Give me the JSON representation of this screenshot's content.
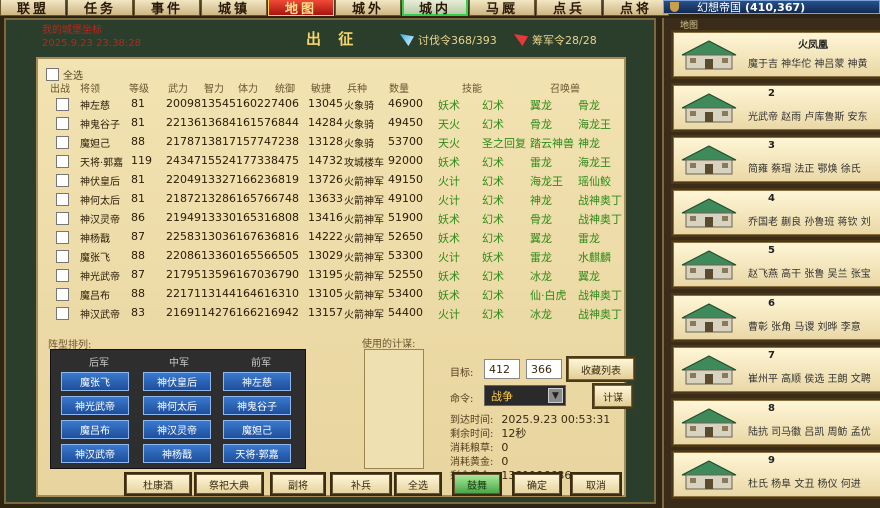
{
  "nav": {
    "tabs": [
      "联盟",
      "任务",
      "事件",
      "城镇",
      "地图",
      "城外",
      "城内",
      "马厩",
      "点兵",
      "点将"
    ],
    "active_index": 4
  },
  "empire": {
    "name": "幻想帝国",
    "coords": "(410,367)"
  },
  "background_info": {
    "line1": "我的城堡坐标",
    "line2": "2025.9.23 23:38:28"
  },
  "dialog": {
    "title": "出 征",
    "counter_1": "讨伐令368/393",
    "counter_2": "筹军令28/28"
  },
  "roster": {
    "select_all_label": "全选",
    "headers": [
      "出战",
      "将领",
      "等级",
      "武力",
      "智力",
      "体力",
      "统御",
      "敏捷",
      "兵种",
      "数量",
      "技能",
      "召唤兽"
    ],
    "rows": [
      {
        "name": "神左慈",
        "level": "81",
        "wu": "20098",
        "zhi": "13545",
        "ti": "160227",
        "tong": "406",
        "min": "13045",
        "bing": "火象骑",
        "num": "46900",
        "s1": "妖术",
        "s2": "幻术",
        "b1": "翼龙",
        "b2": "骨龙"
      },
      {
        "name": "神鬼谷子",
        "level": "81",
        "wu": "22136",
        "zhi": "13684",
        "ti": "161576",
        "tong": "844",
        "min": "14284",
        "bing": "火象骑",
        "num": "49450",
        "s1": "天火",
        "s2": "幻术",
        "b1": "骨龙",
        "b2": "海龙王"
      },
      {
        "name": "魔妲己",
        "level": "88",
        "wu": "21787",
        "zhi": "13817",
        "ti": "157747",
        "tong": "238",
        "min": "13128",
        "bing": "火象骑",
        "num": "53700",
        "s1": "天火",
        "s2": "圣之回复",
        "b1": "踏云神兽",
        "b2": "神龙"
      },
      {
        "name": "天将·郭嘉",
        "level": "119",
        "wu": "24347",
        "zhi": "15524",
        "ti": "177338",
        "tong": "475",
        "min": "14732",
        "bing": "攻城楼车",
        "num": "92000",
        "s1": "妖术",
        "s2": "幻术",
        "b1": "雷龙",
        "b2": "海龙王"
      },
      {
        "name": "神伏皇后",
        "level": "81",
        "wu": "22049",
        "zhi": "13327",
        "ti": "166236",
        "tong": "819",
        "min": "13726",
        "bing": "火箭神军",
        "num": "49150",
        "s1": "火计",
        "s2": "幻术",
        "b1": "海龙王",
        "b2": "瑶仙鲛"
      },
      {
        "name": "神何太后",
        "level": "81",
        "wu": "21872",
        "zhi": "13286",
        "ti": "165766",
        "tong": "748",
        "min": "13633",
        "bing": "火箭神军",
        "num": "49100",
        "s1": "火计",
        "s2": "幻术",
        "b1": "神龙",
        "b2": "战神奥丁"
      },
      {
        "name": "神汉灵帝",
        "level": "86",
        "wu": "21949",
        "zhi": "13330",
        "ti": "165316",
        "tong": "808",
        "min": "13416",
        "bing": "火箭神军",
        "num": "51900",
        "s1": "妖术",
        "s2": "幻术",
        "b1": "骨龙",
        "b2": "战神奥丁"
      },
      {
        "name": "神杨戬",
        "level": "87",
        "wu": "22583",
        "zhi": "13036",
        "ti": "167636",
        "tong": "816",
        "min": "14222",
        "bing": "火箭神军",
        "num": "52650",
        "s1": "妖术",
        "s2": "幻术",
        "b1": "翼龙",
        "b2": "雷龙"
      },
      {
        "name": "魔张飞",
        "level": "88",
        "wu": "22086",
        "zhi": "13360",
        "ti": "165566",
        "tong": "505",
        "min": "13029",
        "bing": "火箭神军",
        "num": "53300",
        "s1": "火计",
        "s2": "妖术",
        "b1": "雷龙",
        "b2": "水麒麟"
      },
      {
        "name": "神光武帝",
        "level": "87",
        "wu": "21795",
        "zhi": "13596",
        "ti": "167036",
        "tong": "790",
        "min": "13195",
        "bing": "火箭神军",
        "num": "52550",
        "s1": "妖术",
        "s2": "幻术",
        "b1": "冰龙",
        "b2": "翼龙"
      },
      {
        "name": "魔吕布",
        "level": "88",
        "wu": "22171",
        "zhi": "13144",
        "ti": "164616",
        "tong": "310",
        "min": "13105",
        "bing": "火箭神军",
        "num": "53400",
        "s1": "妖术",
        "s2": "幻术",
        "b1": "仙·白虎",
        "b2": "战神奥丁"
      },
      {
        "name": "神汉武帝",
        "level": "83",
        "wu": "21691",
        "zhi": "14276",
        "ti": "166216",
        "tong": "942",
        "min": "13157",
        "bing": "火箭神军",
        "num": "54400",
        "s1": "火计",
        "s2": "幻术",
        "b1": "冰龙",
        "b2": "战神奥丁"
      }
    ]
  },
  "formation": {
    "label": "阵型排列:",
    "headers": [
      "后军",
      "中军",
      "前军"
    ],
    "rows": [
      [
        "魔张飞",
        "神伏皇后",
        "神左慈"
      ],
      [
        "神光武帝",
        "神何太后",
        "神鬼谷子"
      ],
      [
        "魔吕布",
        "神汉灵帝",
        "魔妲己"
      ],
      [
        "神汉武帝",
        "神杨戬",
        "天将·郭嘉"
      ]
    ]
  },
  "strategy": {
    "label": "使用的计谋:"
  },
  "target": {
    "label": "目标:",
    "x": "412",
    "y": "366",
    "favorites_button": "收藏列表"
  },
  "command": {
    "label": "命令:",
    "selected": "战争",
    "arrow": "▼",
    "strategy_button": "计谋"
  },
  "info": [
    {
      "key": "到达时间:",
      "value": "2025.9.23 00:53:31"
    },
    {
      "key": "剩余时间:",
      "value": "12秒"
    },
    {
      "key": "消耗粮草:",
      "value": "0"
    },
    {
      "key": "消耗黄金:",
      "value": "0"
    },
    {
      "key": "剩余黄金:",
      "value": "1381196636"
    }
  ],
  "bottom_buttons": [
    "杜康酒",
    "祭祀大典",
    "副将",
    "补兵",
    "全选",
    "鼓舞",
    "确定",
    "取消"
  ],
  "city_list": {
    "title": "地图",
    "items": [
      {
        "num": "",
        "name": "火凤凰",
        "members": "魔于吉 神华佗 神吕蒙 神黄"
      },
      {
        "num": "2",
        "name": "",
        "members": "光武帝 赵雨 卢库鲁斯 安东"
      },
      {
        "num": "3",
        "name": "",
        "members": "简雍 蔡瑁 法正 鄂焕 徐氏"
      },
      {
        "num": "4",
        "name": "",
        "members": "乔国老 蒯良 孙鲁班 蒋钦 刘"
      },
      {
        "num": "5",
        "name": "",
        "members": "赵飞燕 高干 张鲁 吴兰 张宝"
      },
      {
        "num": "6",
        "name": "",
        "members": "曹彰 张角 马谡 刘晔 李意"
      },
      {
        "num": "7",
        "name": "",
        "members": "崔州平 高顺 侯选 王朗 文聘"
      },
      {
        "num": "8",
        "name": "",
        "members": "陆抗 司马徽 吕凯 周鲂 孟优"
      },
      {
        "num": "9",
        "name": "",
        "members": "杜氏 杨阜 文丑 杨仪 何进"
      }
    ]
  }
}
